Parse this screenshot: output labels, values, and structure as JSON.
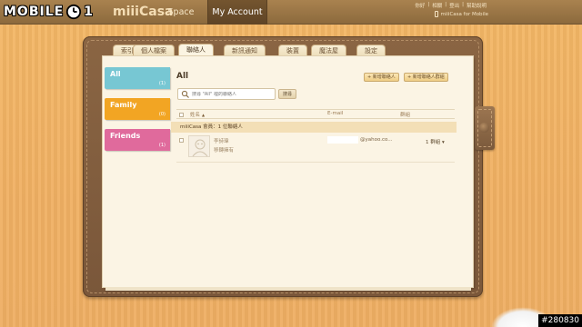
{
  "watermark": {
    "logo_left": "MOBILE",
    "logo_right": "1",
    "post_id": "#280830"
  },
  "header": {
    "brand": "miiiCasa",
    "nav": [
      {
        "label": "Space"
      },
      {
        "label": "My Account"
      }
    ],
    "toplinks": [
      "你好",
      "|",
      "相關",
      "|",
      "登出",
      "|",
      "幫助說明"
    ],
    "mobile_link": "miiiCasa for Mobile"
  },
  "top_tabs": [
    {
      "label": "索引"
    },
    {
      "label": "個人檔案"
    },
    {
      "label": "聯絡人"
    },
    {
      "label": "新訊通知"
    },
    {
      "label": "裝置"
    },
    {
      "label": "魔法屋"
    },
    {
      "label": "設定"
    }
  ],
  "side_tabs": [
    {
      "label": "All",
      "count": "(1)"
    },
    {
      "label": "Family",
      "count": "(0)"
    },
    {
      "label": "Friends",
      "count": "(1)"
    }
  ],
  "content": {
    "title": "All",
    "add_contact_label": "+ 新增聯絡人",
    "add_group_label": "+ 新增聯絡人群組",
    "search_placeholder": "搜尋 \"All\" 裡的聯絡人",
    "search_button": "搜尋",
    "columns": {
      "name": "姓名",
      "email": "E-mail",
      "group": "群組"
    },
    "group_header": "miiiCasa 會員：1 位聯絡人",
    "contacts": [
      {
        "name": "李詩瑋",
        "action": "移轉擁有",
        "email": "@yahoo.co...",
        "group": "1 群組"
      }
    ]
  },
  "colors": {
    "all_tab": "#77c7d3",
    "family_tab": "#f2a523",
    "friends_tab": "#e06a9c"
  },
  "icons": [
    "search-icon",
    "sort-asc-icon",
    "chevron-down-icon",
    "phone-icon",
    "avatar-placeholder-icon"
  ]
}
